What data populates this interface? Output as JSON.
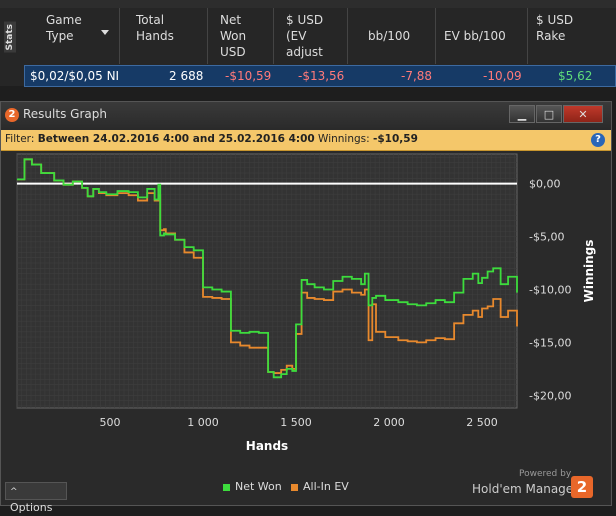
{
  "stats_tab": "Stats",
  "table": {
    "headers": [
      {
        "label": "Game\nType"
      },
      {
        "label": "Total\nHands"
      },
      {
        "label": "Net\nWon\nUSD"
      },
      {
        "label": "$ USD\n(EV\nadjust"
      },
      {
        "label": "bb/100"
      },
      {
        "label": "EV bb/100"
      },
      {
        "label": "$ USD\nRake"
      }
    ],
    "row": [
      "$0,02/$0,05 NI",
      "2 688",
      "-$10,59",
      "-$13,56",
      "-7,88",
      "-10,09",
      "$5,62"
    ]
  },
  "colors": {
    "positive": "#5fdc7a",
    "negative": "#ff6a6a",
    "green_line": "#3ddc3d",
    "orange_line": "#e8892d",
    "accent": "#e8672a"
  },
  "window": {
    "title": "Results Graph",
    "filter_label": "Filter:",
    "filter_text": "Between 24.02.2016 4:00 and 25.02.2016 4:00",
    "winnings_label": "Winnings:",
    "winnings_value": "-$10,59",
    "options_label": "Options",
    "powered_by": "Powered by",
    "brand": "Hold'em Manager",
    "brand_num": "2",
    "app_num": "2"
  },
  "chart_data": {
    "type": "line",
    "xlabel": "Hands",
    "ylabel": "Winnings",
    "x_ticks": [
      500,
      1000,
      1500,
      2000,
      2500
    ],
    "x_tick_labels": [
      "500",
      "1 000",
      "1 500",
      "2 000",
      "2 500"
    ],
    "y_ticks": [
      0,
      -5,
      -10,
      -15,
      -20
    ],
    "y_tick_labels": [
      "$0,00",
      "-$5,00",
      "-$10,00",
      "-$15,00",
      "-$20,00"
    ],
    "xlim": [
      0,
      2688
    ],
    "ylim": [
      -21.2,
      2.8
    ],
    "series": [
      {
        "name": "Net Won",
        "color": "#3ddc3d",
        "x": [
          0,
          40,
          80,
          130,
          200,
          250,
          300,
          350,
          380,
          410,
          440,
          480,
          540,
          600,
          650,
          700,
          740,
          760,
          770,
          790,
          800,
          850,
          900,
          950,
          1000,
          1050,
          1100,
          1150,
          1200,
          1250,
          1300,
          1350,
          1380,
          1420,
          1450,
          1480,
          1500,
          1530,
          1560,
          1600,
          1650,
          1700,
          1750,
          1800,
          1850,
          1870,
          1890,
          1910,
          1930,
          1980,
          2050,
          2100,
          2150,
          2200,
          2250,
          2300,
          2350,
          2400,
          2450,
          2480,
          2500,
          2530,
          2560,
          2600,
          2640,
          2688
        ],
        "y": [
          0.4,
          2.3,
          1.8,
          1.0,
          0.3,
          -0.1,
          0.2,
          -0.4,
          -1.2,
          -0.5,
          -0.8,
          -1.0,
          -0.7,
          -0.8,
          -1.3,
          -0.5,
          -1.5,
          -0.1,
          -4.9,
          -4.7,
          -4.8,
          -5.3,
          -6.0,
          -6.3,
          -9.8,
          -10.0,
          -10.2,
          -13.9,
          -14.1,
          -14.0,
          -14.1,
          -17.8,
          -18.3,
          -18.0,
          -17.5,
          -17.7,
          -13.3,
          -9.1,
          -9.5,
          -9.8,
          -10.0,
          -9.2,
          -8.8,
          -9.0,
          -9.5,
          -8.5,
          -11.5,
          -10.8,
          -10.6,
          -11.0,
          -11.2,
          -11.4,
          -11.5,
          -11.3,
          -11.0,
          -11.2,
          -10.3,
          -9.0,
          -8.5,
          -9.4,
          -8.9,
          -8.3,
          -8.0,
          -9.5,
          -8.8,
          -10.3
        ]
      },
      {
        "name": "All-In EV",
        "color": "#e8892d",
        "x": [
          0,
          40,
          80,
          130,
          200,
          250,
          300,
          350,
          380,
          410,
          440,
          480,
          540,
          600,
          650,
          700,
          740,
          760,
          770,
          790,
          800,
          850,
          900,
          950,
          1000,
          1050,
          1100,
          1150,
          1200,
          1250,
          1300,
          1350,
          1380,
          1420,
          1450,
          1480,
          1500,
          1530,
          1560,
          1600,
          1650,
          1700,
          1750,
          1800,
          1850,
          1870,
          1890,
          1910,
          1930,
          1980,
          2050,
          2100,
          2150,
          2200,
          2250,
          2300,
          2350,
          2400,
          2450,
          2480,
          2500,
          2530,
          2560,
          2600,
          2640,
          2688
        ],
        "y": [
          0.4,
          2.3,
          1.8,
          1.0,
          0.3,
          -0.1,
          0.2,
          -0.4,
          -1.2,
          -0.5,
          -0.9,
          -1.1,
          -0.9,
          -1.1,
          -1.6,
          -0.9,
          -1.6,
          -1.1,
          -4.4,
          -4.3,
          -4.7,
          -5.3,
          -6.5,
          -7.0,
          -10.7,
          -10.8,
          -10.9,
          -15.0,
          -15.3,
          -15.5,
          -15.5,
          -17.8,
          -17.9,
          -17.6,
          -17.2,
          -17.5,
          -14.2,
          -10.3,
          -10.8,
          -10.9,
          -11.0,
          -10.2,
          -10.0,
          -10.3,
          -10.5,
          -10.0,
          -14.8,
          -11.4,
          -14.0,
          -14.5,
          -14.8,
          -14.9,
          -15.0,
          -14.8,
          -14.6,
          -14.7,
          -13.2,
          -12.4,
          -12.0,
          -12.6,
          -11.8,
          -11.6,
          -10.9,
          -12.6,
          -12.0,
          -13.5
        ]
      }
    ]
  }
}
